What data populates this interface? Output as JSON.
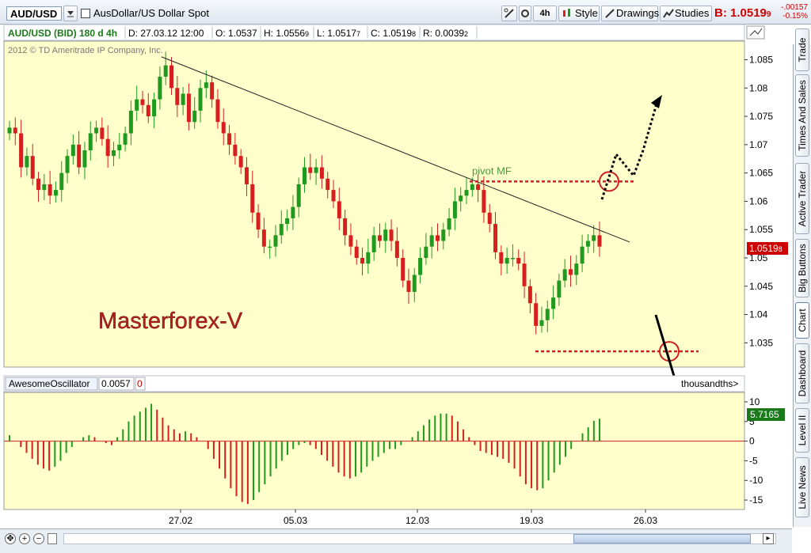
{
  "toolbar": {
    "symbol": "AUD/USD",
    "description": "AusDollar/US Dollar Spot",
    "timeframe": "4h",
    "style_label": "Style",
    "drawings_label": "Drawings",
    "studies_label": "Studies",
    "bid_label": "B: 1.0519",
    "bid_sup": "9",
    "change": "-.00157",
    "change_pct": "-0.15%"
  },
  "header": {
    "title": "AUD/USD (BID) 180 d 4h",
    "date": "D: 27.03.12 12:00",
    "open": "O: 1.0537",
    "high": "H: 1.0556",
    "high_sup": "9",
    "low": "L: 1.0517",
    "low_sup": "7",
    "close": "C: 1.0519",
    "close_sup": "8",
    "range": "R: 0.0039",
    "range_sup": "2"
  },
  "copyright": "2012 © TD Ameritrade IP Company, Inc.",
  "watermark": "Masterforex-V",
  "pivot_label": "pivot MF",
  "price_tag": "1.0519",
  "price_tag_sup": "8",
  "oscillator": {
    "name": "AwesomeOscillator",
    "value": "0.0057",
    "extra": "0",
    "units": "thousandths>",
    "current_tag": "5.7165"
  },
  "right_tabs": [
    "Trade",
    "Times And Sales",
    "Active Trader",
    "Big Buttons",
    "Chart",
    "Dashboard",
    "Level II",
    "Live News"
  ],
  "colors": {
    "up": "#1f9a1f",
    "down": "#d81f1f",
    "background": "#ffffcc",
    "accent": "#cc0000",
    "pivot": "#4c9a3c"
  },
  "chart_data": {
    "type": "candlestick",
    "ylim": [
      1.031,
      1.088
    ],
    "y_ticks": [
      1.035,
      1.04,
      1.045,
      1.05,
      1.055,
      1.06,
      1.065,
      1.07,
      1.075,
      1.08,
      1.085
    ],
    "x_ticks": [
      "27.02",
      "05.03",
      "12.03",
      "19.03",
      "26.03"
    ],
    "close_series": [
      1.073,
      1.072,
      1.066,
      1.068,
      1.064,
      1.062,
      1.063,
      1.061,
      1.062,
      1.065,
      1.068,
      1.07,
      1.066,
      1.069,
      1.072,
      1.073,
      1.071,
      1.068,
      1.069,
      1.07,
      1.072,
      1.076,
      1.078,
      1.077,
      1.075,
      1.078,
      1.082,
      1.084,
      1.08,
      1.077,
      1.079,
      1.074,
      1.076,
      1.08,
      1.081,
      1.078,
      1.074,
      1.072,
      1.07,
      1.068,
      1.066,
      1.063,
      1.058,
      1.055,
      1.052,
      1.052,
      1.054,
      1.056,
      1.057,
      1.059,
      1.063,
      1.066,
      1.065,
      1.066,
      1.064,
      1.062,
      1.06,
      1.057,
      1.054,
      1.052,
      1.05,
      1.049,
      1.051,
      1.054,
      1.053,
      1.055,
      1.053,
      1.05,
      1.046,
      1.044,
      1.047,
      1.05,
      1.052,
      1.054,
      1.053,
      1.055,
      1.057,
      1.06,
      1.061,
      1.062,
      1.063,
      1.062,
      1.058,
      1.056,
      1.051,
      1.049,
      1.05,
      1.05,
      1.049,
      1.045,
      1.042,
      1.038,
      1.039,
      1.041,
      1.043,
      1.046,
      1.048,
      1.047,
      1.049,
      1.052,
      1.053,
      1.054,
      1.052
    ],
    "high_annotation": 1.0855,
    "pivot_level": 1.0635,
    "support_level": 1.0335,
    "trendline": {
      "from": 1.0855,
      "to": 1.0528
    },
    "oscillator": {
      "name": "AwesomeOscillator",
      "ylim": [
        -17,
        12
      ],
      "y_ticks": [
        10,
        5,
        0,
        -5,
        -10,
        -15
      ],
      "values": [
        1.5,
        0,
        -1.5,
        -3,
        -4.5,
        -6,
        -7,
        -7.5,
        -6.5,
        -5,
        -3,
        -1.5,
        0,
        1,
        1.5,
        1,
        0,
        -0.5,
        -1,
        1,
        3,
        5,
        6.5,
        7.5,
        8.5,
        9.5,
        8,
        6,
        4,
        3,
        2,
        2.5,
        2,
        1,
        0,
        -2,
        -4.5,
        -7,
        -9.5,
        -12,
        -14,
        -15.5,
        -16,
        -15,
        -13,
        -11,
        -9,
        -7,
        -5,
        -3.5,
        -2,
        -1,
        -0.5,
        -1,
        -2,
        -3.5,
        -5,
        -6.5,
        -8,
        -9,
        -9.5,
        -9,
        -8,
        -6.5,
        -5,
        -4,
        -3,
        -2,
        -2,
        -1,
        0,
        1,
        2.5,
        4,
        5.5,
        6.5,
        7,
        7,
        6.5,
        5,
        3,
        1,
        -1,
        -2.5,
        -3,
        -3.5,
        -4,
        -4.5,
        -5.5,
        -7,
        -9,
        -11,
        -12,
        -12.5,
        -12,
        -10,
        -8,
        -6,
        -4,
        -2,
        0,
        2,
        3.5,
        5.2,
        5.7
      ]
    }
  }
}
